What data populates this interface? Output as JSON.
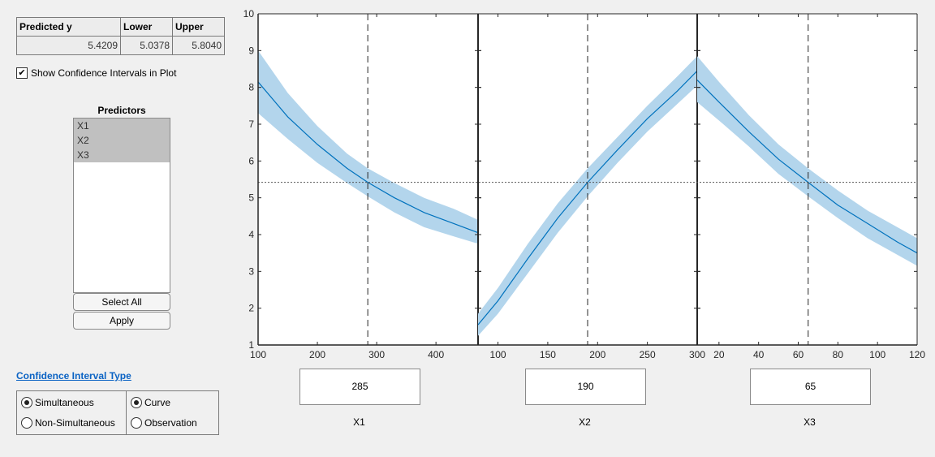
{
  "prediction_table": {
    "headers": [
      "Predicted y",
      "Lower",
      "Upper"
    ],
    "values": [
      "5.4209",
      "5.0378",
      "5.8040"
    ]
  },
  "show_ci": {
    "label": "Show Confidence Intervals in Plot",
    "checked": true
  },
  "predictors": {
    "title": "Predictors",
    "items": [
      "X1",
      "X2",
      "X3"
    ],
    "selected": [
      "X1",
      "X2",
      "X3"
    ],
    "select_all_label": "Select All",
    "apply_label": "Apply"
  },
  "ci_type": {
    "title": "Confidence Interval Type",
    "group1": [
      {
        "label": "Simultaneous",
        "selected": true
      },
      {
        "label": "Non-Simultaneous",
        "selected": false
      }
    ],
    "group2": [
      {
        "label": "Curve",
        "selected": true
      },
      {
        "label": "Observation",
        "selected": false
      }
    ]
  },
  "colors": {
    "line": "#0072bd",
    "band": "#b3d5ec",
    "axis": "#262626"
  },
  "predictor_inputs": [
    {
      "name": "X1",
      "value": "285"
    },
    {
      "name": "X2",
      "value": "190"
    },
    {
      "name": "X3",
      "value": "65"
    }
  ],
  "chart_data": {
    "type": "line",
    "ylim": [
      1,
      10
    ],
    "yticks": [
      "1",
      "2",
      "3",
      "4",
      "5",
      "6",
      "7",
      "8",
      "9",
      "10"
    ],
    "predicted_y": 5.4209,
    "panels": [
      {
        "xlabel": "X1",
        "xlim": [
          100,
          471
        ],
        "current": 285,
        "xticks": [
          100,
          200,
          300,
          400
        ],
        "x": [
          100,
          150,
          200,
          250,
          285,
          330,
          380,
          430,
          471
        ],
        "y": [
          8.15,
          7.2,
          6.45,
          5.8,
          5.42,
          5.0,
          4.6,
          4.3,
          4.05
        ],
        "lower": [
          7.3,
          6.6,
          5.95,
          5.4,
          5.04,
          4.6,
          4.2,
          3.95,
          3.75
        ],
        "upper": [
          9.0,
          7.85,
          6.95,
          6.2,
          5.8,
          5.4,
          5.0,
          4.7,
          4.4
        ]
      },
      {
        "xlabel": "X2",
        "xlim": [
          80,
          300
        ],
        "current": 190,
        "xticks": [
          100,
          150,
          200,
          250,
          300
        ],
        "x": [
          80,
          100,
          130,
          160,
          190,
          220,
          250,
          280,
          300
        ],
        "y": [
          1.55,
          2.2,
          3.35,
          4.45,
          5.42,
          6.3,
          7.15,
          7.9,
          8.45
        ],
        "lower": [
          1.25,
          1.85,
          2.95,
          4.05,
          5.04,
          5.95,
          6.8,
          7.55,
          8.05
        ],
        "upper": [
          1.85,
          2.55,
          3.75,
          4.85,
          5.8,
          6.65,
          7.5,
          8.3,
          8.85
        ]
      },
      {
        "xlabel": "X3",
        "xlim": [
          9,
          120
        ],
        "current": 65,
        "xticks": [
          20,
          40,
          60,
          80,
          100,
          120
        ],
        "x": [
          9,
          20,
          35,
          50,
          65,
          80,
          95,
          110,
          120
        ],
        "y": [
          8.2,
          7.6,
          6.8,
          6.05,
          5.42,
          4.8,
          4.3,
          3.8,
          3.5
        ],
        "lower": [
          7.6,
          7.1,
          6.4,
          5.65,
          5.04,
          4.45,
          3.9,
          3.45,
          3.15
        ],
        "upper": [
          8.85,
          8.15,
          7.25,
          6.45,
          5.8,
          5.2,
          4.65,
          4.2,
          3.9
        ]
      }
    ]
  }
}
